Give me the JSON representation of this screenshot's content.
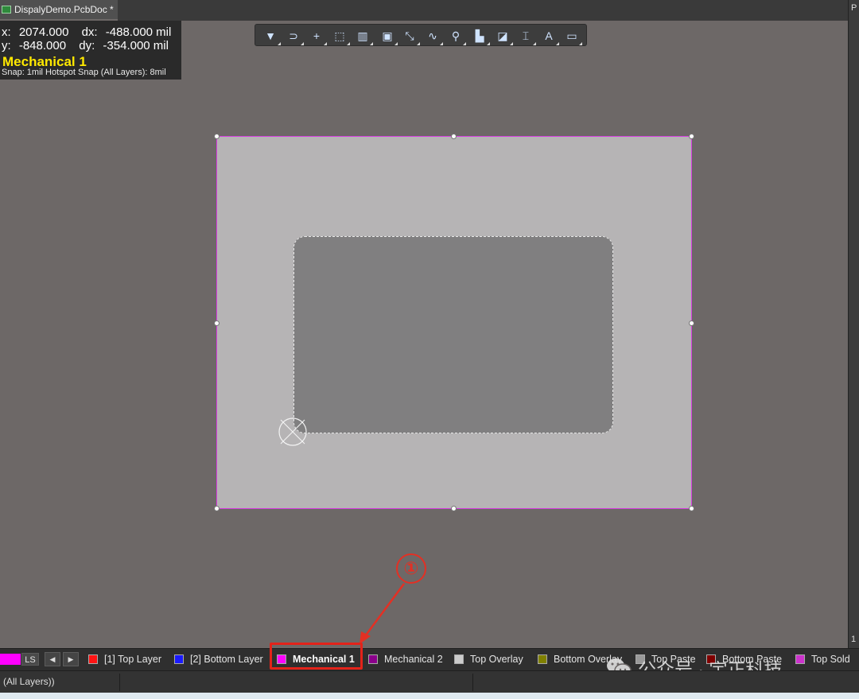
{
  "document": {
    "tab_title": "DispalyDemo.PcbDoc *"
  },
  "right_panel": {
    "labels": [
      "P",
      "1"
    ]
  },
  "hud": {
    "x_label": "x:",
    "x_value": "2074.000",
    "dx_label": "dx:",
    "dx_value": "-488.000 mil",
    "y_label": "y:",
    "y_value": "-848.000",
    "dy_label": "dy:",
    "dy_value": "-354.000 mil",
    "layer": "Mechanical 1",
    "snap": "Snap: 1mil Hotspot Snap (All Layers): 8mil"
  },
  "toolbar": {
    "buttons": [
      {
        "icon": "filter-icon",
        "glyph": "▼"
      },
      {
        "icon": "interactive-route-magnet-icon",
        "glyph": "⊃"
      },
      {
        "icon": "crosshair-plus-icon",
        "glyph": "+"
      },
      {
        "icon": "select-rectangle-icon",
        "glyph": "⬚"
      },
      {
        "icon": "align-icon",
        "glyph": "▥"
      },
      {
        "icon": "component-icon",
        "glyph": "▣"
      },
      {
        "icon": "route-track-icon",
        "glyph": "⤡"
      },
      {
        "icon": "diff-pair-icon",
        "glyph": "∿"
      },
      {
        "icon": "via-pin-icon",
        "glyph": "⚲"
      },
      {
        "icon": "polygon-fill-icon",
        "glyph": "▙"
      },
      {
        "icon": "keepout-icon",
        "glyph": "◪"
      },
      {
        "icon": "dimension-icon",
        "glyph": "⌶"
      },
      {
        "icon": "string-text-icon",
        "glyph": "A"
      },
      {
        "icon": "rectangle-outline-icon",
        "glyph": "▭"
      }
    ]
  },
  "annotation": {
    "marker": "①"
  },
  "layer_bar": {
    "ls_label": "LS",
    "prev_glyph": "◀",
    "next_glyph": "▶",
    "tabs": [
      {
        "label": "[1] Top Layer",
        "color": "#ff1414"
      },
      {
        "label": "[2] Bottom Layer",
        "color": "#1a1aff"
      },
      {
        "label": "Mechanical 1",
        "color": "#ff00ff",
        "active": true
      },
      {
        "label": "Mechanical 2",
        "color": "#8b008b"
      },
      {
        "label": "Top Overlay",
        "color": "#cccccc"
      },
      {
        "label": "Bottom Overlay",
        "color": "#808000"
      },
      {
        "label": "Top Paste",
        "color": "#999999"
      },
      {
        "label": "Bottom Paste",
        "color": "#800000"
      },
      {
        "label": "Top Sold",
        "color": "#cc33cc"
      }
    ]
  },
  "status_bar": {
    "selection_filter": "(All Layers))"
  },
  "watermark": {
    "text": "公众号 · 宇正科技"
  }
}
